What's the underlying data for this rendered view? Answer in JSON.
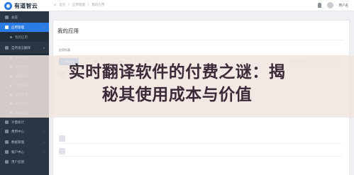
{
  "header": {
    "logo_text": "有道智云",
    "breadcrumbs": [
      "首页",
      "应用管理",
      "我的应用"
    ],
    "user_name": "用户名"
  },
  "sidebar": {
    "items": [
      {
        "label": "总览",
        "type": "item"
      },
      {
        "label": "应用管理",
        "type": "active"
      },
      {
        "label": "我的应用",
        "type": "sub"
      },
      {
        "label": "自然语言翻译",
        "type": "item"
      },
      {
        "label": "文本翻译",
        "type": "sub"
      },
      {
        "label": "图片翻译",
        "type": "sub"
      },
      {
        "label": "语音翻译",
        "type": "sub"
      },
      {
        "label": "文档翻译",
        "type": "sub"
      },
      {
        "label": "语音合成",
        "type": "sub"
      },
      {
        "label": "文字识别",
        "type": "sub"
      },
      {
        "label": "智能语音",
        "type": "sub"
      },
      {
        "label": "计量统计",
        "type": "item"
      },
      {
        "label": "费用中心",
        "type": "item"
      },
      {
        "label": "数据管理",
        "type": "item"
      },
      {
        "label": "账户中心",
        "type": "item"
      },
      {
        "label": "用户反馈",
        "type": "item"
      }
    ]
  },
  "main": {
    "page_title": "我的应用",
    "section_label": "应用列表",
    "buttons": [
      "创建应用",
      "全部",
      "启用",
      "停用"
    ],
    "search_placeholder": "请输入应用名称"
  },
  "banner": {
    "title_line1": "实时翻译软件的付费之谜：揭",
    "title_line2": "秘其使用成本与价值"
  },
  "colors": {
    "sidebar_bg": "#2b3544",
    "accent": "#2a7be4",
    "banner_bg": "#f0e5df",
    "banner_text": "#3a2b38"
  }
}
